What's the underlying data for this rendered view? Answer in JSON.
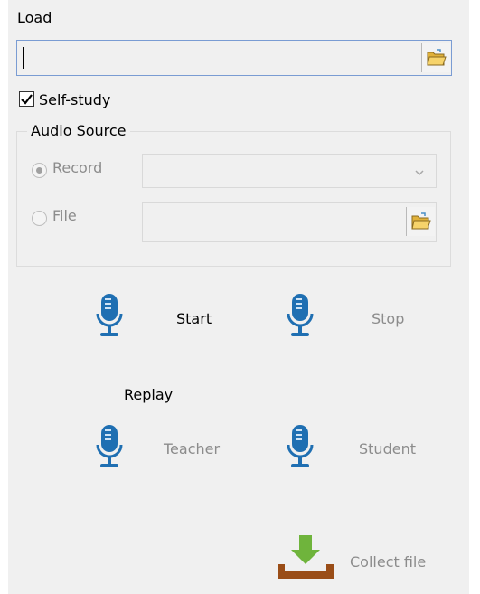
{
  "load": {
    "label": "Load",
    "value": ""
  },
  "self_study": {
    "label": "Self-study",
    "checked": true
  },
  "audio_source": {
    "title": "Audio Source",
    "options": [
      {
        "label": "Record",
        "selected": true
      },
      {
        "label": "File",
        "selected": false
      }
    ],
    "record_device": "",
    "file_path": ""
  },
  "recording": {
    "start_label": "Start",
    "stop_label": "Stop"
  },
  "replay": {
    "label": "Replay",
    "teacher_label": "Teacher",
    "student_label": "Student"
  },
  "collect": {
    "label": "Collect file"
  },
  "icons": {
    "folder": "folder-open-icon",
    "microphone": "microphone-icon",
    "download": "download-tray-icon",
    "dropdown": "chevron-down-icon"
  },
  "colors": {
    "mic_blue": "#1f6fb2",
    "download_green": "#6fb43c",
    "tray_brown": "#9a4d17",
    "disabled_text": "#8c8c8c",
    "focus_border": "#7a9cd3"
  }
}
